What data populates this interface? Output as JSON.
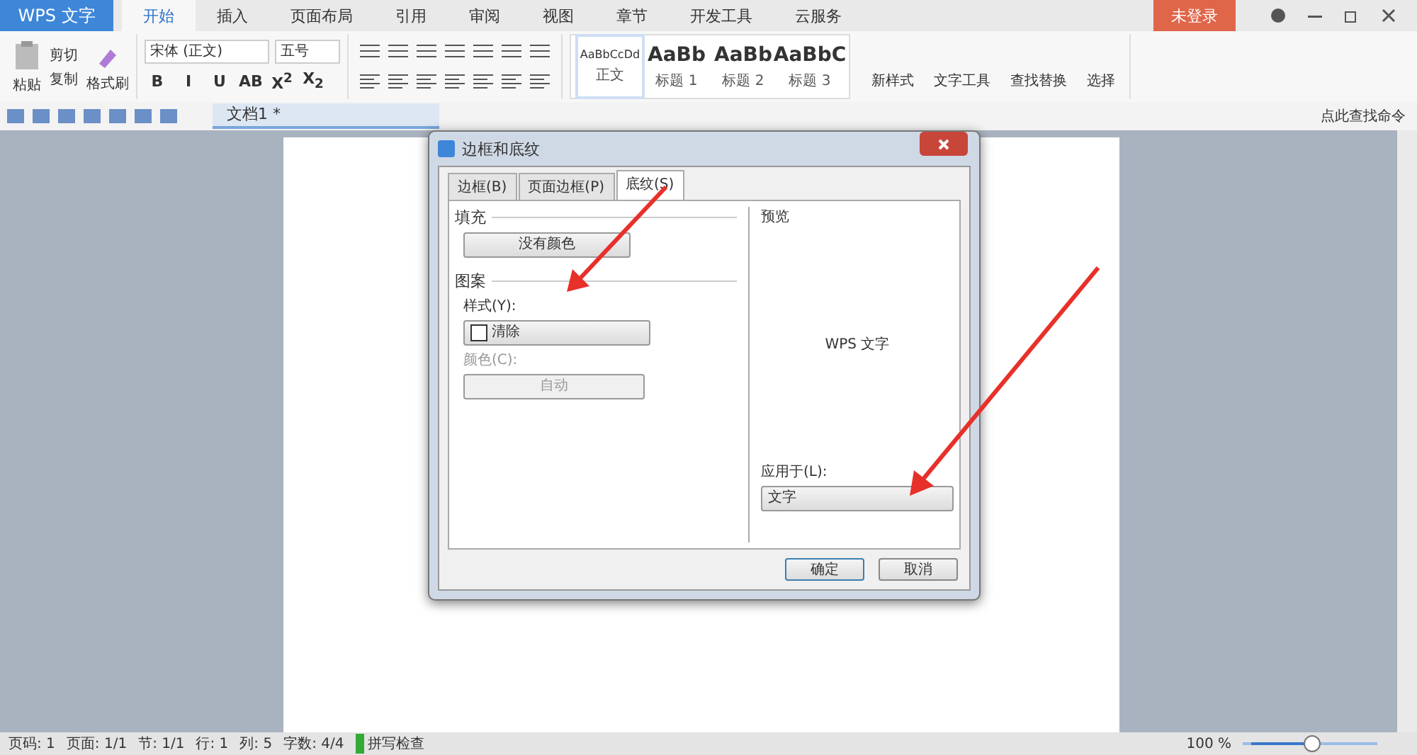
{
  "app_button": "WPS 文字",
  "tabs": [
    {
      "label": "开始",
      "selected": true
    },
    {
      "label": "插入",
      "selected": false
    },
    {
      "label": "页面布局",
      "selected": false
    },
    {
      "label": "引用",
      "selected": false
    },
    {
      "label": "审阅",
      "selected": false
    },
    {
      "label": "视图",
      "selected": false
    },
    {
      "label": "章节",
      "selected": false
    },
    {
      "label": "开发工具",
      "selected": false
    },
    {
      "label": "云服务",
      "selected": false
    }
  ],
  "login_button": "未登录",
  "ribbon": {
    "paste": "粘贴",
    "cut": "剪切",
    "copy": "复制",
    "format_painter": "格式刷",
    "font": "宋体 (正文)",
    "font_size": "五号",
    "format_buttons": [
      "B",
      "I",
      "U",
      "AB",
      "X$^{2}$",
      "X$_{2}$"
    ],
    "styles": [
      {
        "sample": "AaBbCcDd",
        "label": "正文",
        "selected": true
      },
      {
        "sample": "AaBb",
        "label": "标题 1",
        "selected": false
      },
      {
        "sample": "AaBb",
        "label": "标题 2",
        "selected": false
      },
      {
        "sample": "AaBbC",
        "label": "标题 3",
        "selected": false
      }
    ],
    "big_buttons": [
      "新样式",
      "文字工具",
      "查找替换",
      "选择"
    ]
  },
  "command_search": "点此查找命令",
  "doc_tab": "文档1 *",
  "dialog": {
    "title": "边框和底纹",
    "tabs": [
      {
        "label": "边框(B)",
        "selected": false
      },
      {
        "label": "页面边框(P)",
        "selected": false
      },
      {
        "label": "底纹(S)",
        "selected": true
      }
    ],
    "fill_label": "填充",
    "fill_value": "没有颜色",
    "pattern_label": "图案",
    "style_label": "样式(Y):",
    "style_value": "清除",
    "color_label": "颜色(C):",
    "color_value": "自动",
    "color_disabled": true,
    "preview_label": "预览",
    "preview_text": "WPS 文字",
    "apply_label": "应用于(L):",
    "apply_value": "文字",
    "buttons": [
      "确定",
      "取消"
    ]
  },
  "status_bar": {
    "items": [
      "页码: 1",
      "页面: 1/1",
      "节: 1/1",
      "行: 1",
      "列: 5",
      "字数: 4/4"
    ],
    "spell_check": "拼写检查",
    "zoom": "100 %",
    "zoom_slider": {
      "level": 0.52
    }
  }
}
